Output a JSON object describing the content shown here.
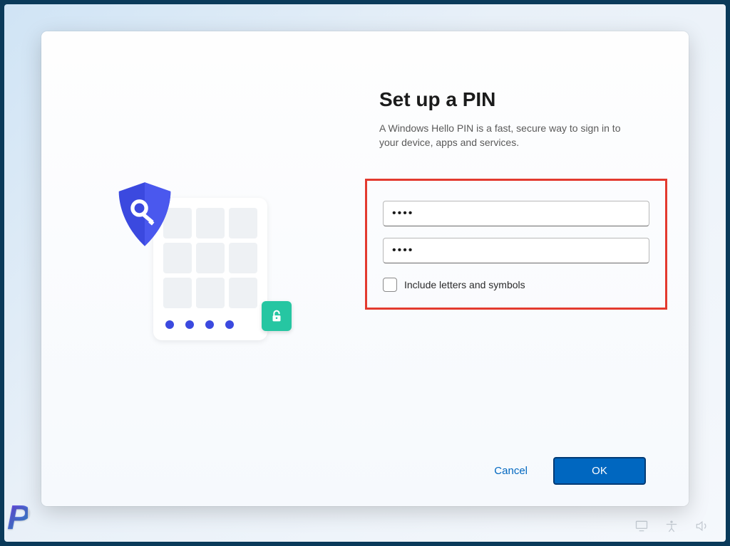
{
  "dialog": {
    "heading": "Set up a PIN",
    "description": "A Windows Hello PIN is a fast, secure way to sign in to your device, apps and services.",
    "pin_value": "••••",
    "confirm_pin_value": "••••",
    "checkbox_label": "Include letters and symbols",
    "cancel_label": "Cancel",
    "ok_label": "OK"
  },
  "colors": {
    "accent": "#0067c0",
    "highlight_border": "#e33a2f",
    "shield": "#3b49df",
    "unlock_badge": "#26c6a2"
  },
  "watermark": "P",
  "icons": {
    "shield": "shield-key-icon",
    "unlock": "unlock-icon"
  }
}
